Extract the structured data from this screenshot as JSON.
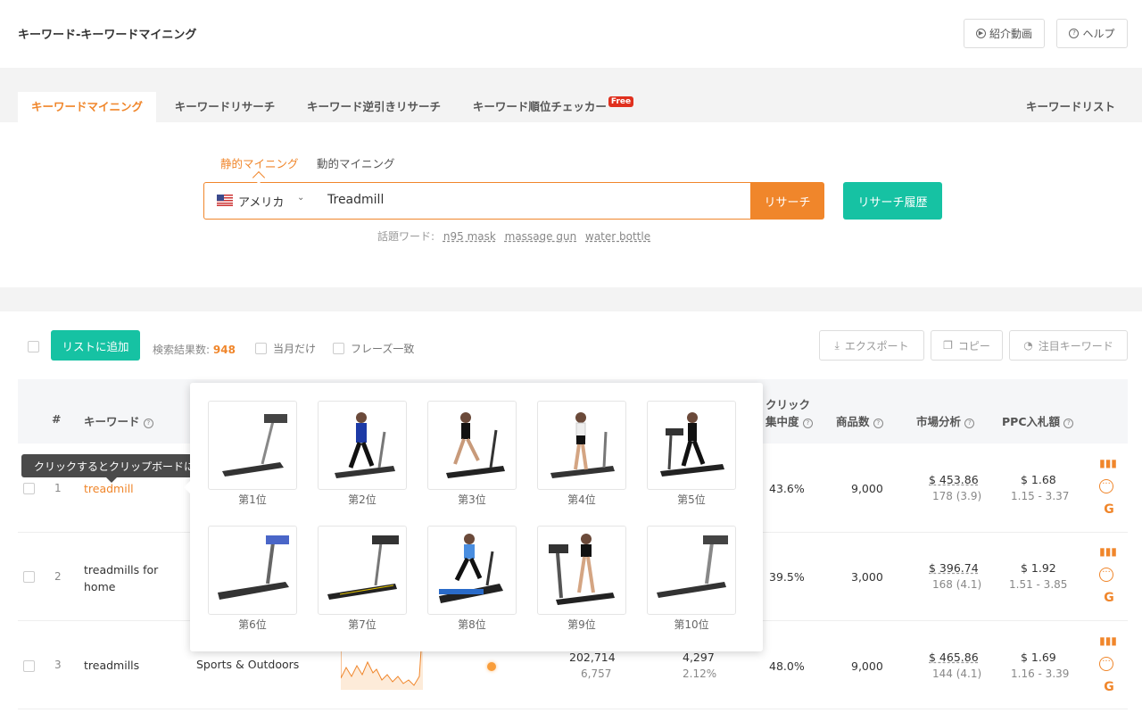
{
  "header": {
    "title": "キーワード-キーワードマイニング",
    "video_label": "紹介動画",
    "help_label": "ヘルプ"
  },
  "tabs": [
    {
      "label": "キーワードマイニング",
      "active": true
    },
    {
      "label": "キーワードリサーチ"
    },
    {
      "label": "キーワード逆引きリサーチ"
    },
    {
      "label": "キーワード順位チェッカー",
      "badge": "Free"
    },
    {
      "label": "キーワードリスト"
    }
  ],
  "subtabs": [
    {
      "label": "静的マイニング",
      "active": true
    },
    {
      "label": "動的マイニング"
    }
  ],
  "search": {
    "country": "アメリカ",
    "keyword": "Treadmill",
    "search_label": "リサーチ",
    "history_label": "リサーチ履歴"
  },
  "hot": {
    "label": "話題ワード:",
    "words": [
      "n95 mask",
      "massage gun",
      "water bottle"
    ]
  },
  "toolbar": {
    "add_label": "リストに追加",
    "count_label": "検索結果数:",
    "count_value": "948",
    "month_only": "当月だけ",
    "phrase_match": "フレーズ一致",
    "export_label": "エクスポート",
    "copy_label": "コピー",
    "watch_label": "注目キーワード"
  },
  "table": {
    "headers": {
      "num": "#",
      "keyword": "キーワード",
      "click_top": "クリック",
      "click_bottom": "集中度",
      "products": "商品数",
      "market": "市場分析",
      "ppc": "PPC入札額"
    },
    "rows": [
      {
        "num": "1",
        "keyword": "treadmill",
        "click": "43.6%",
        "products": "9,000",
        "market_price": "$ 453.86",
        "market_sub": "178 (3.9)",
        "ppc": "$ 1.68",
        "ppc_range": "1.15 - 3.37"
      },
      {
        "num": "2",
        "keyword": "treadmills for home",
        "click": "39.5%",
        "products": "3,000",
        "market_price": "$ 396.74",
        "market_sub": "168 (4.1)",
        "ppc": "$ 1.92",
        "ppc_range": "1.51 - 3.85"
      },
      {
        "num": "3",
        "keyword": "treadmills",
        "category": "Sports & Outdoors",
        "searches": "202,714",
        "searches_sub": "6,757",
        "purchases": "4,297",
        "purchases_sub": "2.12%",
        "click": "48.0%",
        "products": "9,000",
        "market_price": "$ 465.86",
        "market_sub": "144 (4.1)",
        "ppc": "$ 1.69",
        "ppc_range": "1.16 - 3.39"
      }
    ]
  },
  "tooltip": "クリックするとクリップボードにコピーされる",
  "popup": {
    "ranks": [
      "第1位",
      "第2位",
      "第3位",
      "第4位",
      "第5位",
      "第6位",
      "第7位",
      "第8位",
      "第9位",
      "第10位"
    ]
  },
  "colors": {
    "accent": "#f0862b",
    "teal": "#16c2a3"
  }
}
